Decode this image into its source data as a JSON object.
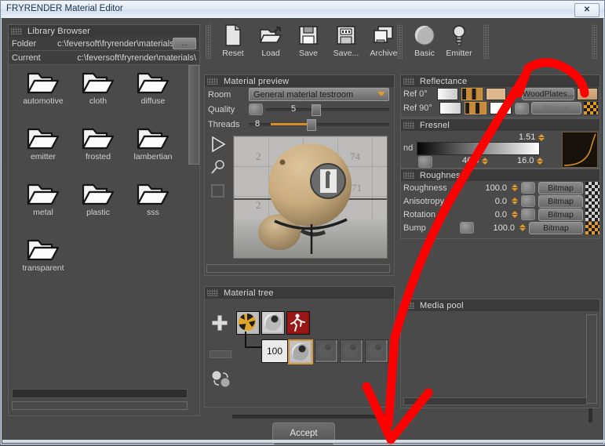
{
  "window": {
    "title": "FRYRENDER Material Editor",
    "close_label": "✕"
  },
  "library": {
    "panel_title": "Library Browser",
    "folder_label": "Folder",
    "folder_value": "c:\\feversoft\\fryrender\\materials\\",
    "current_label": "Current",
    "current_value": "c:\\feversoft\\fryrender\\materials\\",
    "browse_button": "...",
    "folders": [
      "automotive",
      "cloth",
      "diffuse",
      "emitter",
      "frosted",
      "lambertian",
      "metal",
      "plastic",
      "sss",
      "transparent"
    ]
  },
  "toolbar": {
    "buttons": [
      {
        "label": "Reset",
        "icon": "page-icon"
      },
      {
        "label": "Load",
        "icon": "open-folder-icon"
      },
      {
        "label": "Save",
        "icon": "floppy-icon"
      },
      {
        "label": "Save...",
        "icon": "floppy-as-icon"
      },
      {
        "label": "Archive",
        "icon": "archive-icon"
      }
    ],
    "modes": [
      {
        "label": "Basic",
        "icon": "sphere-icon"
      },
      {
        "label": "Emitter",
        "icon": "lightbulb-icon"
      }
    ]
  },
  "material_preview": {
    "panel_title": "Material preview",
    "room_label": "Room",
    "room_value": "General material testroom",
    "quality_label": "Quality",
    "quality_value": "5",
    "threads_label": "Threads",
    "threads_value": "8",
    "controls": [
      "play-icon",
      "zoom-icon",
      "crop-icon"
    ]
  },
  "material_tree": {
    "panel_title": "Material tree",
    "add_icon": "plus-icon",
    "weight_value": "100",
    "nodes": [
      "checkered-ball-icon",
      "gray-ball-icon",
      "exit-icon",
      "gray-ball-icon",
      "dim-ball-icon",
      "dim-ball-icon",
      "dim-ball-icon"
    ],
    "swap_icon": "swap-balls-icon"
  },
  "reflectance": {
    "panel_title": "Reflectance",
    "rows": [
      {
        "label": "Ref 0°",
        "swatch1": "#e9e9e9",
        "swatch2": "#d6973b",
        "swatch3": "#dcb68c",
        "checked": true,
        "check_glyph": "✔",
        "button": "WoodPlates...",
        "thumb": "wood-thumb"
      },
      {
        "label": "Ref 90°",
        "swatch1": "#f2f2f2",
        "swatch2": "#d6973b",
        "swatch3": "#ffffff",
        "checked": false,
        "check_glyph": "",
        "button": "Bitmap",
        "thumb": "checker-orange"
      }
    ]
  },
  "fresnel": {
    "panel_title": "Fresnel",
    "nd_label": "nd",
    "nd_value": "1.51",
    "value_left": "46.5",
    "value_right": "16.0"
  },
  "roughness": {
    "panel_title": "Roughness",
    "rows": [
      {
        "label": "Roughness",
        "value": "100.0",
        "button": "Bitmap",
        "thumb": "checker-gray",
        "has_knob": true,
        "has_spin": false
      },
      {
        "label": "Anisotropy",
        "value": "0.0",
        "button": "Bitmap",
        "thumb": "checker-gray",
        "has_knob": true,
        "has_spin": false
      },
      {
        "label": "Rotation",
        "value": "0.0",
        "button": "Bitmap",
        "thumb": "checker-gray",
        "has_knob": true,
        "has_spin": true
      },
      {
        "label": "Bump",
        "value": "100.0",
        "button": "Bitmap",
        "thumb": "checker-orange",
        "has_knob": true,
        "has_spin": true
      }
    ]
  },
  "media_pool": {
    "panel_title": "Media pool"
  },
  "footer": {
    "accept_label": "Accept"
  },
  "annotation": {
    "color": "#fe0000",
    "type": "red-arrow-annotation"
  }
}
